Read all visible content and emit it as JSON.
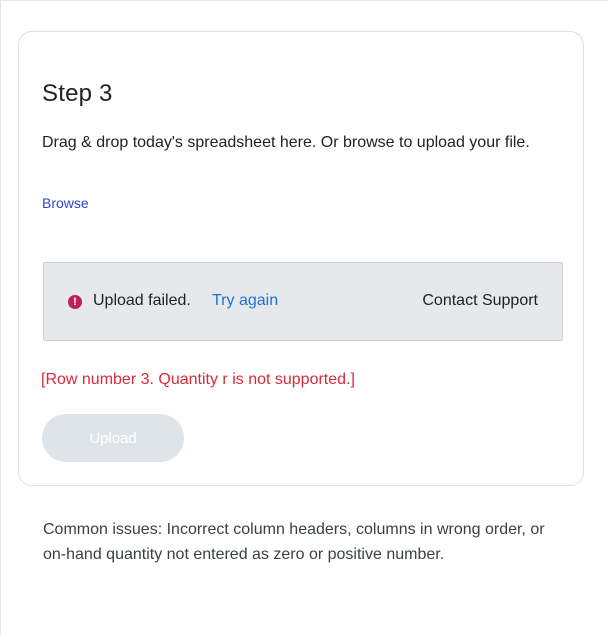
{
  "step": {
    "title": "Step 3",
    "instructions": "Drag & drop today's spreadsheet here. Or browse to upload your file.",
    "browse_label": "Browse"
  },
  "status": {
    "icon": "alert-icon",
    "icon_glyph": "!",
    "message": "Upload failed.",
    "retry_label": "Try again",
    "support_label": "Contact Support"
  },
  "error": {
    "message": "[Row number 3. Quantity r is not supported.]"
  },
  "upload": {
    "label": "Upload"
  },
  "help": {
    "common_issues": "Common issues: Incorrect column headers, columns in wrong order, or on-hand quantity not entered as zero or positive number."
  },
  "colors": {
    "link": "#2a45d6",
    "retry_link": "#1a73d9",
    "error": "#d92b3a",
    "alert_icon": "#c01f5a",
    "status_background": "#e6e8eb",
    "button_disabled": "#dfe4ea"
  }
}
